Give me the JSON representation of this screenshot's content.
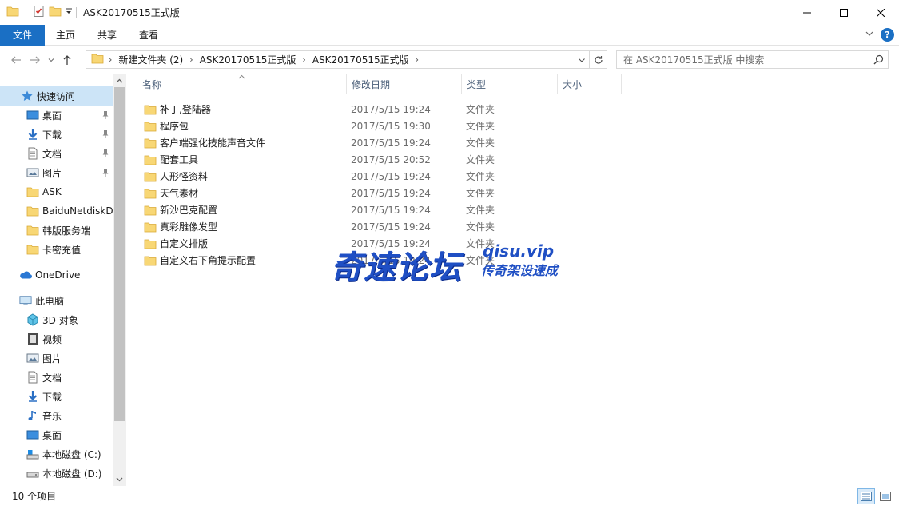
{
  "window": {
    "title": "ASK20170515正式版"
  },
  "ribbon": {
    "tabs": [
      {
        "label": "文件"
      },
      {
        "label": "主页"
      },
      {
        "label": "共享"
      },
      {
        "label": "查看"
      }
    ]
  },
  "address": {
    "crumbs": [
      "新建文件夹 (2)",
      "ASK20170515正式版",
      "ASK20170515正式版"
    ],
    "search_placeholder": "在 ASK20170515正式版 中搜索"
  },
  "navpane": {
    "quick_access": {
      "label": "快速访问",
      "items": [
        {
          "label": "桌面",
          "icon": "desktop-icon",
          "pinned": true
        },
        {
          "label": "下载",
          "icon": "download-icon",
          "pinned": true
        },
        {
          "label": "文档",
          "icon": "document-icon",
          "pinned": true
        },
        {
          "label": "图片",
          "icon": "picture-icon",
          "pinned": true
        },
        {
          "label": "ASK",
          "icon": "folder-icon",
          "pinned": false
        },
        {
          "label": "BaiduNetdiskD",
          "icon": "folder-icon",
          "pinned": false
        },
        {
          "label": "韩版服务端",
          "icon": "folder-icon",
          "pinned": false
        },
        {
          "label": "卡密充值",
          "icon": "folder-icon",
          "pinned": false
        }
      ]
    },
    "onedrive": {
      "label": "OneDrive"
    },
    "this_pc": {
      "label": "此电脑",
      "items": [
        {
          "label": "3D 对象",
          "icon": "3d-objects-icon"
        },
        {
          "label": "视频",
          "icon": "video-icon"
        },
        {
          "label": "图片",
          "icon": "picture-icon"
        },
        {
          "label": "文档",
          "icon": "document-icon"
        },
        {
          "label": "下载",
          "icon": "download-icon"
        },
        {
          "label": "音乐",
          "icon": "music-icon"
        },
        {
          "label": "桌面",
          "icon": "desktop-icon"
        },
        {
          "label": "本地磁盘 (C:)",
          "icon": "system-drive-icon"
        },
        {
          "label": "本地磁盘 (D:)",
          "icon": "drive-icon"
        }
      ]
    }
  },
  "columns": {
    "name": "名称",
    "date": "修改日期",
    "type": "类型",
    "size": "大小"
  },
  "files": [
    {
      "name": "补丁,登陆器",
      "date": "2017/5/15 19:24",
      "type": "文件夹"
    },
    {
      "name": "程序包",
      "date": "2017/5/15 19:30",
      "type": "文件夹"
    },
    {
      "name": "客户端强化技能声音文件",
      "date": "2017/5/15 19:24",
      "type": "文件夹"
    },
    {
      "name": "配套工具",
      "date": "2017/5/15 20:52",
      "type": "文件夹"
    },
    {
      "name": "人形怪资料",
      "date": "2017/5/15 19:24",
      "type": "文件夹"
    },
    {
      "name": "天气素材",
      "date": "2017/5/15 19:24",
      "type": "文件夹"
    },
    {
      "name": "新沙巴克配置",
      "date": "2017/5/15 19:24",
      "type": "文件夹"
    },
    {
      "name": "真彩雕像发型",
      "date": "2017/5/15 19:24",
      "type": "文件夹"
    },
    {
      "name": "自定义排版",
      "date": "2017/5/15 19:24",
      "type": "文件夹"
    },
    {
      "name": "自定义右下角提示配置",
      "date": "2017/5/15 19:24",
      "type": "文件夹"
    }
  ],
  "watermark": {
    "main": "奇速论坛",
    "domain": "qisu.vip",
    "sub": "传奇架设速成"
  },
  "status": {
    "item_count": "10 个项目"
  },
  "colors": {
    "accent": "#1a6fc4",
    "selection": "#cce4f7",
    "folder": "#f8d775",
    "watermark": "#1f4fc4"
  }
}
